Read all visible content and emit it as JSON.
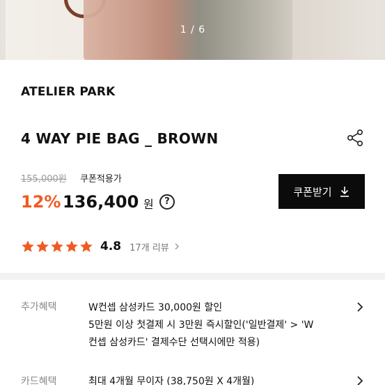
{
  "hero": {
    "pager": "1 / 6"
  },
  "brand": "ATELIER PARK",
  "product": {
    "title": "4 WAY PIE BAG _ BROWN"
  },
  "price": {
    "original": "155,000원",
    "coupon_note": "쿠폰적용가",
    "discount": "12%",
    "sale": "136,400",
    "currency": "원",
    "help_glyph": "?"
  },
  "coupon_button": {
    "label": "쿠폰받기",
    "icon": "download-icon"
  },
  "rating": {
    "score": "4.8",
    "stars": 5,
    "reviews": "17개 리뷰",
    "star_color": "#ef5b23"
  },
  "benefits": {
    "label": "추가혜택",
    "lines": [
      "W컨셉 삼성카드 30,000원 할인",
      "5만원 이상 첫결제 시 3만원 즉시할인('일반결제' > 'W",
      "컨셉 삼성카드' 결제수단 선택시에만 적용)"
    ]
  },
  "card": {
    "label": "카드혜택",
    "text": "최대 4개월 무이자 (38,750원 X 4개월)"
  },
  "colors": {
    "accent": "#ef5b23",
    "button": "#0b0b0b",
    "muted": "#8a8a8a"
  }
}
